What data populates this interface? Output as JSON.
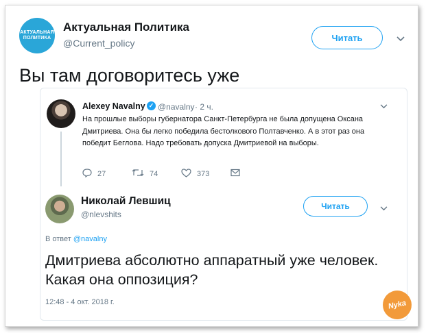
{
  "main_tweet": {
    "avatar_text_line1": "АКТУАЛЬНАЯ",
    "avatar_text_line2": "ПОЛИТИКА",
    "name": "Актуальная Политика",
    "handle": "@Current_policy",
    "follow_label": "Читать",
    "text": "Вы там договоритесь уже"
  },
  "quoted_tweet": {
    "name": "Alexey Navalny",
    "verified_mark": "✓",
    "handle": "@navalny",
    "time": "· 2 ч.",
    "text": "На прошлые выборы губернатора Санкт-Петербурга не была допущена Оксана Дмитриева. Она бы легко победила бестолкового Полтавченко. А в этот раз она победит Беглова. Надо требовать допуска Дмитриевой на выборы.",
    "replies": "27",
    "retweets": "74",
    "likes": "373"
  },
  "reply_tweet": {
    "name": "Николай Левшиц",
    "handle": "@nlevshits",
    "follow_label": "Читать",
    "reply_prefix": "В ответ",
    "reply_handle": "@navalny",
    "text": "Дмитриева абсолютно аппаратный уже человек. Какая она оппозиция?",
    "timestamp": "12:48 - 4 окт. 2018 г."
  },
  "watermark": "Nyka",
  "icons": {
    "chevron": "chevron-down-icon",
    "reply": "reply-icon",
    "retweet": "retweet-icon",
    "like": "heart-icon",
    "dm": "envelope-icon"
  },
  "colors": {
    "accent": "#1da1f2",
    "muted": "#657786",
    "text": "#14171a",
    "avatar_brand": "#2aa6d8",
    "watermark": "#f29a3a"
  }
}
